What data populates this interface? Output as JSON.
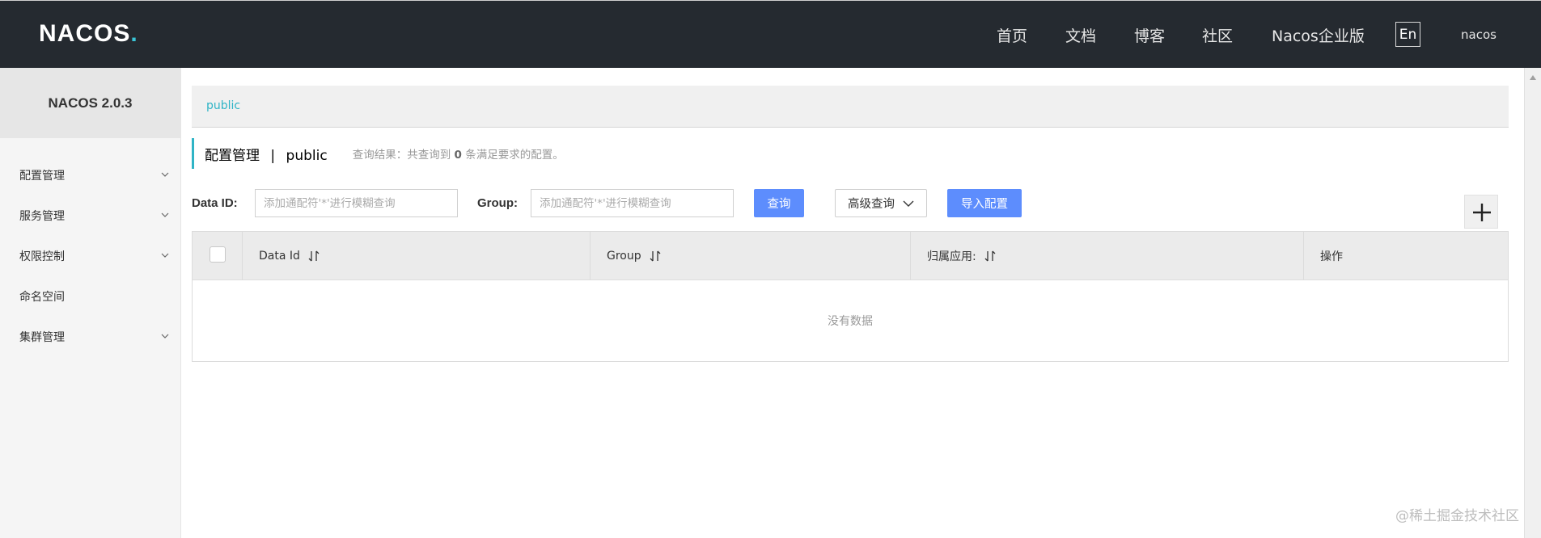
{
  "header": {
    "logo_text": "NACOS",
    "logo_dot": ".",
    "nav_items": [
      "首页",
      "文档",
      "博客",
      "社区",
      "Nacos企业版"
    ],
    "lang_button": "En",
    "user": "nacos"
  },
  "sidebar": {
    "version": "NACOS 2.0.3",
    "items": [
      {
        "label": "配置管理",
        "expandable": true
      },
      {
        "label": "服务管理",
        "expandable": true
      },
      {
        "label": "权限控制",
        "expandable": true
      },
      {
        "label": "命名空间",
        "expandable": false
      },
      {
        "label": "集群管理",
        "expandable": true
      }
    ]
  },
  "breadcrumb": {
    "namespace": "public"
  },
  "page_title": {
    "title": "配置管理",
    "separator": "|",
    "namespace": "public",
    "result_prefix": "查询结果：共查询到",
    "result_count": "0",
    "result_suffix": "条满足要求的配置。"
  },
  "filters": {
    "data_id_label": "Data ID:",
    "data_id_placeholder": "添加通配符'*'进行模糊查询",
    "data_id_value": "",
    "group_label": "Group:",
    "group_placeholder": "添加通配符'*'进行模糊查询",
    "group_value": "",
    "search_button": "查询",
    "advanced_button": "高级查询",
    "import_button": "导入配置"
  },
  "table": {
    "columns": [
      "Data Id",
      "Group",
      "归属应用:",
      "操作"
    ],
    "rows": [],
    "empty_text": "没有数据"
  },
  "watermark": "@稀土掘金技术社区",
  "colors": {
    "header_bg": "#252a30",
    "accent": "#2fb4c6",
    "primary_button": "#5d8dfd"
  }
}
